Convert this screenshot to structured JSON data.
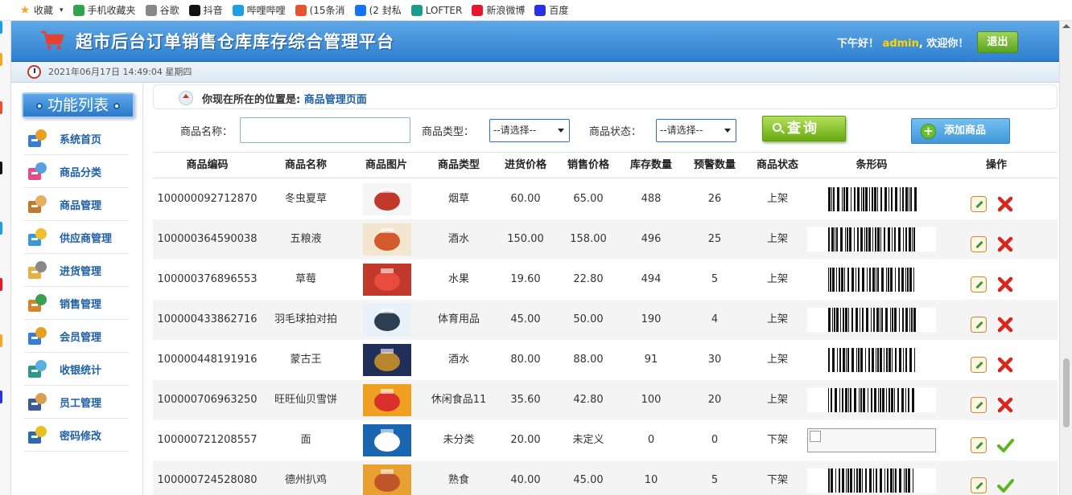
{
  "bookmarks": [
    {
      "label": "收藏",
      "icon": "star-icon",
      "color": "#f5a623"
    },
    {
      "label": "手机收藏夹",
      "icon": "phone-icon",
      "color": "#2ea44f"
    },
    {
      "label": "谷歌",
      "icon": "page-icon",
      "color": "#888888"
    },
    {
      "label": "抖音",
      "icon": "tiktok-icon",
      "color": "#111111"
    },
    {
      "label": "哔哩哔哩",
      "icon": "bilibili-icon",
      "color": "#1e9fe0"
    },
    {
      "label": "(15条消",
      "icon": "c-icon",
      "color": "#e8532f"
    },
    {
      "label": "(2 封私",
      "icon": "zhihu-icon",
      "color": "#1772f6"
    },
    {
      "label": "LOFTER",
      "icon": "lofter-icon",
      "color": "#1b9b8a"
    },
    {
      "label": "新浪微博",
      "icon": "weibo-icon",
      "color": "#e6162d"
    },
    {
      "label": "百度",
      "icon": "baidu-icon",
      "color": "#2932e1"
    }
  ],
  "header": {
    "title": "超市后台订单销售仓库库存综合管理平台",
    "greeting_prefix": "下午好！",
    "username": "admin",
    "greeting_suffix": ", 欢迎你！",
    "logout_label": "退出"
  },
  "datetime": "2021年06月17日 14:49:04 星期四",
  "sidebar": {
    "title": "功能列表",
    "items": [
      {
        "label": "系统首页",
        "icon": "home-icon"
      },
      {
        "label": "商品分类",
        "icon": "category-icon"
      },
      {
        "label": "商品管理",
        "icon": "goods-icon"
      },
      {
        "label": "供应商管理",
        "icon": "supplier-icon"
      },
      {
        "label": "进货管理",
        "icon": "purchase-icon"
      },
      {
        "label": "销售管理",
        "icon": "sales-icon"
      },
      {
        "label": "会员管理",
        "icon": "member-icon"
      },
      {
        "label": "收银统计",
        "icon": "cashier-icon"
      },
      {
        "label": "员工管理",
        "icon": "staff-icon"
      },
      {
        "label": "密码修改",
        "icon": "password-icon"
      }
    ]
  },
  "breadcrumb": {
    "prefix": "你现在所在的位置是:",
    "location": "商品管理页面"
  },
  "search": {
    "name_label": "商品名称：",
    "name_value": "",
    "type_label": "商品类型：",
    "type_selected": "--请选择--",
    "status_label": "商品状态：",
    "status_selected": "--请选择--",
    "query_label": "查询",
    "add_label": "添加商品"
  },
  "table": {
    "headers": [
      "商品编码",
      "商品名称",
      "商品图片",
      "商品类型",
      "进货价格",
      "销售价格",
      "库存数量",
      "预警数量",
      "商品状态",
      "条形码",
      "操作"
    ],
    "rows": [
      {
        "code": "100000092712870",
        "name": "冬虫夏草",
        "type": "烟草",
        "buy": "60.00",
        "sell": "65.00",
        "stock": "488",
        "warn": "26",
        "status": "上架",
        "barcode": true,
        "action": "delete"
      },
      {
        "code": "100000364590038",
        "name": "五粮液",
        "type": "酒水",
        "buy": "150.00",
        "sell": "158.00",
        "stock": "496",
        "warn": "25",
        "status": "上架",
        "barcode": true,
        "action": "delete"
      },
      {
        "code": "100000376896553",
        "name": "草莓",
        "type": "水果",
        "buy": "19.60",
        "sell": "22.80",
        "stock": "494",
        "warn": "5",
        "status": "上架",
        "barcode": true,
        "action": "delete"
      },
      {
        "code": "100000433862716",
        "name": "羽毛球拍对拍",
        "type": "体育用品",
        "buy": "45.00",
        "sell": "50.00",
        "stock": "190",
        "warn": "4",
        "status": "上架",
        "barcode": true,
        "action": "delete"
      },
      {
        "code": "100000448191916",
        "name": "蒙古王",
        "type": "酒水",
        "buy": "80.00",
        "sell": "88.00",
        "stock": "91",
        "warn": "30",
        "status": "上架",
        "barcode": true,
        "action": "delete"
      },
      {
        "code": "100000706963250",
        "name": "旺旺仙贝雪饼",
        "type": "休闲食品11",
        "buy": "35.60",
        "sell": "42.80",
        "stock": "100",
        "warn": "20",
        "status": "上架",
        "barcode": true,
        "action": "delete"
      },
      {
        "code": "100000721208557",
        "name": "面",
        "type": "未分类",
        "buy": "20.00",
        "sell": "未定义",
        "stock": "0",
        "warn": "0",
        "status": "下架",
        "barcode": false,
        "action": "approve"
      },
      {
        "code": "100000724528080",
        "name": "德州扒鸡",
        "type": "熟食",
        "buy": "40.00",
        "sell": "45.00",
        "stock": "10",
        "warn": "5",
        "status": "下架",
        "barcode": true,
        "action": "approve"
      }
    ]
  }
}
